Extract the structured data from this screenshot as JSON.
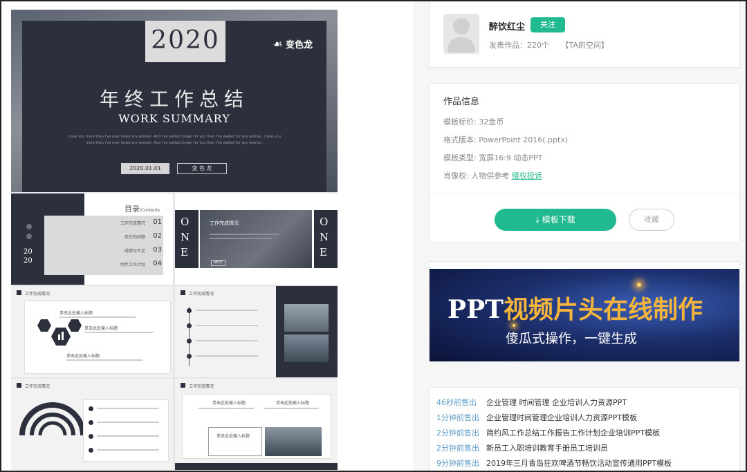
{
  "preview": {
    "cover": {
      "year": "2020",
      "logo": "变色龙",
      "title": "年终工作总结",
      "subtitle": "WORK SUMMARY",
      "body": "I love you more than I've ever loved any woman. And I've waited longer for you than I've waited for any woman. I love you more than I've ever loved any woman. And I've waited longer for you than I've waited for any woman.",
      "date": "2020.01.01",
      "author": "变 色 龙"
    },
    "toc": {
      "heading": "目录",
      "heading_en": "/Contents",
      "year_top": "20",
      "year_bottom": "20",
      "items": [
        {
          "label": "工作完成情况",
          "num": "01"
        },
        {
          "label": "存在的问题",
          "num": "02"
        },
        {
          "label": "成绩与不足",
          "num": "03"
        },
        {
          "label": "明年工作计划",
          "num": "04"
        }
      ]
    },
    "one": {
      "side": "ONE",
      "heading": "工作完成情况",
      "tag": "NEXT"
    },
    "section_title": "工作完成情况",
    "caption": "单击此处输入标题"
  },
  "author_card": {
    "name": "醉饮红尘",
    "follow_label": "关注",
    "works_label": "发表作品：",
    "works_count": "220个",
    "space_link": "【TA的空间】"
  },
  "info_card": {
    "title": "作品信息",
    "rows": [
      {
        "label": "模板标价: ",
        "value": "32金币"
      },
      {
        "label": "格式版本: ",
        "value": "PowerPoint 2016(.pptx)"
      },
      {
        "label": "模板类型: ",
        "value": "宽屏16:9  动态PPT"
      },
      {
        "label": "肖像权: ",
        "value": "人物供参考 "
      }
    ],
    "report_link": "侵权投诉",
    "download_label": "模板下载",
    "collect_label": "收藏"
  },
  "banner": {
    "headline_a": "PPT",
    "headline_b": "视频片头在线制作",
    "tagline": "傻瓜式操作，一键生成"
  },
  "ticker": [
    {
      "time": "46秒前售出",
      "title": "企业管理 时间管理 企业培训人力资源PPT"
    },
    {
      "time": "1分钟前售出",
      "title": "企业管理时间管理企业培训人力资源PPT模板"
    },
    {
      "time": "2分钟前售出",
      "title": "简约风工作总结工作报告工作计划企业培训PPT模板"
    },
    {
      "time": "2分钟前售出",
      "title": "新员工入职培训教育手册员工培训员"
    },
    {
      "time": "9分钟前售出",
      "title": "2019年三月青岛狂欢啤酒节畅饮活动宣传通用PPT模板"
    }
  ],
  "colors": {
    "accent": "#21b98f",
    "dark": "#2c303c",
    "link": "#5f9dc7"
  }
}
